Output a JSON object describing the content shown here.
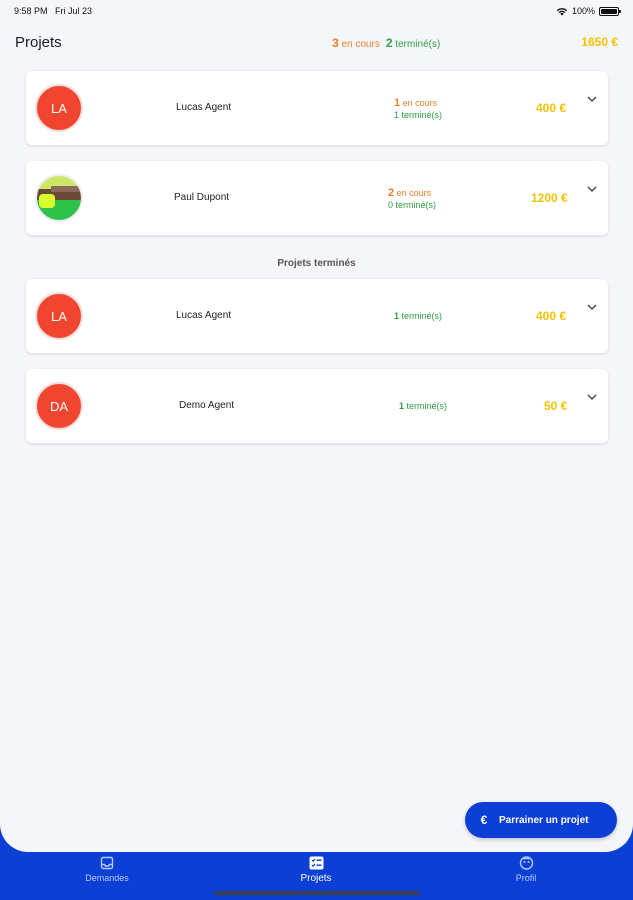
{
  "status_bar": {
    "time": "9:58 PM",
    "date": "Fri Jul 23",
    "battery": "100%"
  },
  "header": {
    "title": "Projets",
    "in_progress_count": "3",
    "in_progress_label": "en cours",
    "finished_count": "2",
    "finished_label": "terminé(s)",
    "total": "1650 €"
  },
  "active_projects": [
    {
      "initials": "LA",
      "name": "Lucas Agent",
      "in_progress_count": "1",
      "in_progress_label": "en cours",
      "finished_count": "1",
      "finished_label": "terminé(s)",
      "amount": "400 €"
    },
    {
      "initials": "",
      "name": "Paul Dupont",
      "in_progress_count": "2",
      "in_progress_label": "en cours",
      "finished_count": "0",
      "finished_label": "terminé(s)",
      "amount": "1200 €"
    }
  ],
  "finished_section_title": "Projets terminés",
  "finished_projects": [
    {
      "initials": "LA",
      "name": "Lucas Agent",
      "finished_count": "1",
      "finished_label": "terminé(s)",
      "amount": "400 €"
    },
    {
      "initials": "DA",
      "name": "Demo Agent",
      "finished_count": "1",
      "finished_label": "terminé(s)",
      "amount": "50 €"
    }
  ],
  "fab": {
    "label": "Parrainer un projet",
    "icon": "euro-icon"
  },
  "tabs": [
    {
      "label": "Demandes",
      "icon": "inbox-icon",
      "active": false
    },
    {
      "label": "Projets",
      "icon": "checklist-icon",
      "active": true
    },
    {
      "label": "Profil",
      "icon": "profile-icon",
      "active": false
    }
  ],
  "colors": {
    "accent": "#0b3fd6",
    "orange": "#f07d2a",
    "green": "#2f9e44",
    "gold": "#f2c100",
    "avatar": "#f0452e"
  }
}
